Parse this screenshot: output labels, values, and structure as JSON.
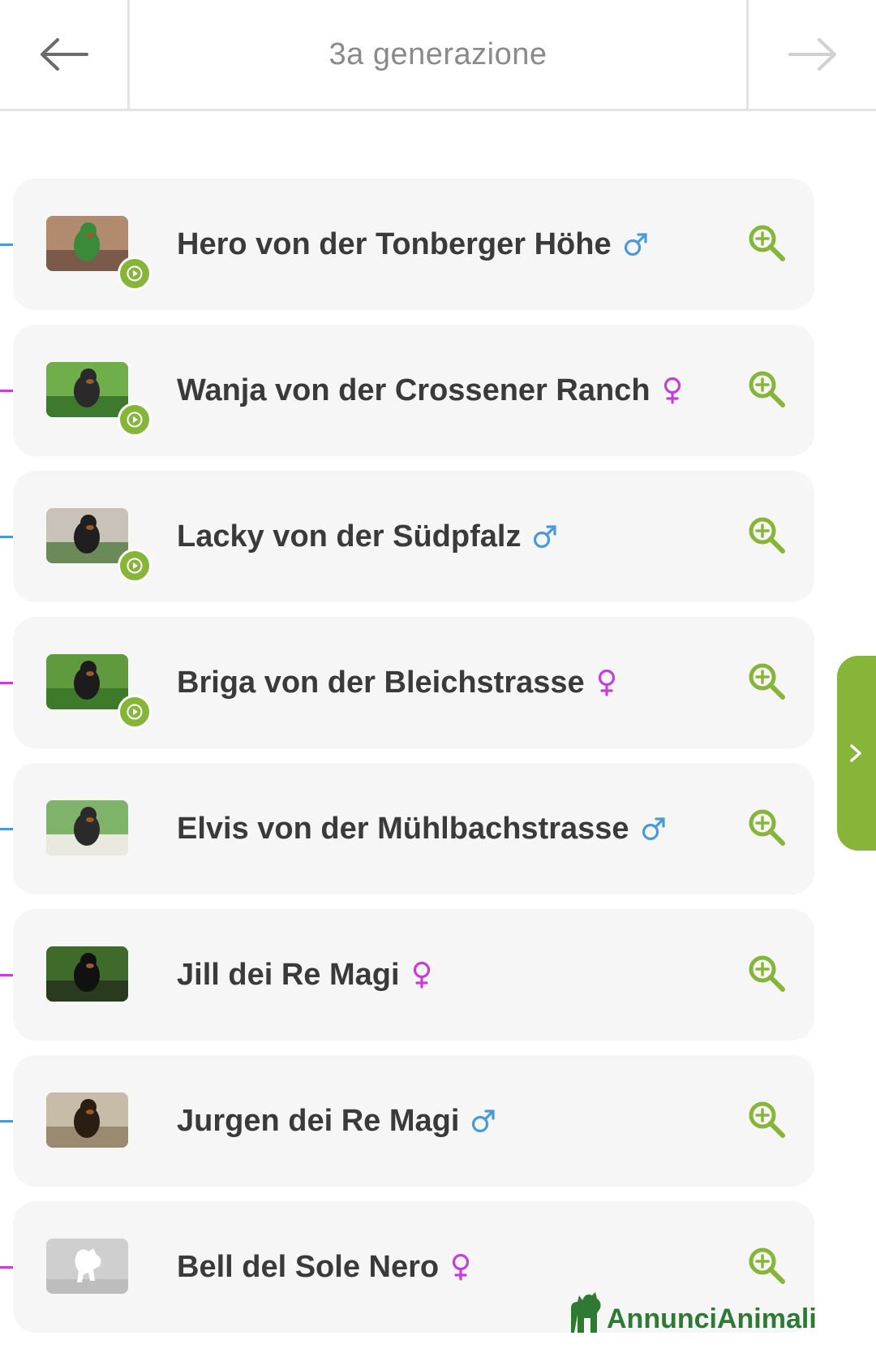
{
  "header": {
    "title": "3a generazione",
    "prev_icon": "arrow-left-icon",
    "next_icon": "arrow-right-icon"
  },
  "colors": {
    "accent": "#86b53a",
    "male": "#4a9ad6",
    "female": "#c53fd6",
    "brand": "#2e7a34"
  },
  "dogs": [
    {
      "name": "Hero von der Tonberger Höhe",
      "sex": "male",
      "has_video": true
    },
    {
      "name": "Wanja von der Crossener Ranch",
      "sex": "female",
      "has_video": true
    },
    {
      "name": "Lacky von der Südpfalz",
      "sex": "male",
      "has_video": true
    },
    {
      "name": "Briga von der Bleichstrasse",
      "sex": "female",
      "has_video": true
    },
    {
      "name": "Elvis von der Mühlbachstrasse",
      "sex": "male",
      "has_video": false
    },
    {
      "name": "Jill dei Re Magi",
      "sex": "female",
      "has_video": false
    },
    {
      "name": "Jurgen dei Re Magi",
      "sex": "male",
      "has_video": false
    },
    {
      "name": "Bell del Sole Nero",
      "sex": "female",
      "has_video": false
    }
  ],
  "side_tab": {
    "icon": "chevron-right-icon"
  },
  "brand": {
    "name": "AnnunciAnimali",
    "icon": "animals-logo-icon"
  }
}
